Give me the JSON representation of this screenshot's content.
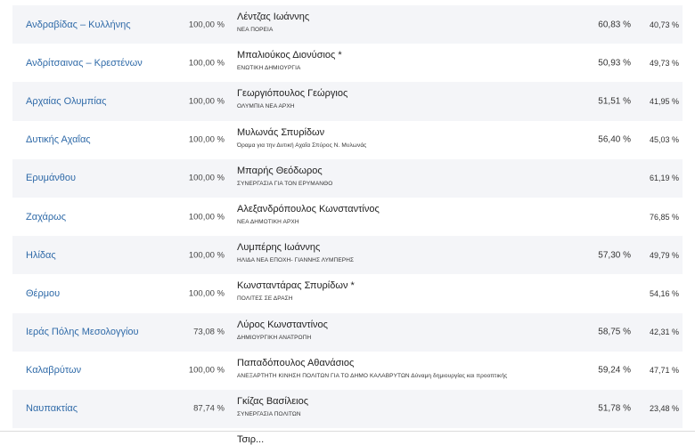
{
  "rows": [
    {
      "municipality": "Ανδραβίδας – Κυλλήνης",
      "count": "100,00 %",
      "name": "Λέντζας Ιωάννης",
      "party": "ΝΕΑ ΠΟΡΕΙΑ",
      "p1": "60,83 %",
      "p2": "40,73 %"
    },
    {
      "municipality": "Ανδρίτσαινας – Κρεστένων",
      "count": "100,00 %",
      "name": "Μπαλιούκος Διονύσιος *",
      "party": "ΕΝΩΤΙΚΗ ΔΗΜΙΟΥΡΓΙΑ",
      "p1": "50,93 %",
      "p2": "49,73 %"
    },
    {
      "municipality": "Αρχαίας Ολυμπίας",
      "count": "100,00 %",
      "name": "Γεωργιόπουλος Γεώργιος",
      "party": "ΟΛΥΜΠΙΑ ΝΕΑ ΑΡΧΗ",
      "p1": "51,51 %",
      "p2": "41,95 %"
    },
    {
      "municipality": "Δυτικής Αχαΐας",
      "count": "100,00 %",
      "name": "Μυλωνάς Σπυρίδων",
      "party": "Όραμα για την Δυτική Αχαΐα Σπύρος Ν. Μυλωνάς",
      "p1": "56,40 %",
      "p2": "45,03 %"
    },
    {
      "municipality": "Ερυμάνθου",
      "count": "100,00 %",
      "name": "Μπαρής Θεόδωρος",
      "party": "ΣΥΝΕΡΓΑΣΙΑ ΓΙΑ ΤΟΝ ΕΡΥΜΑΝΘΟ",
      "p1": "",
      "p2": "61,19 %"
    },
    {
      "municipality": "Ζαχάρως",
      "count": "100,00 %",
      "name": "Αλεξανδρόπουλος Κωνσταντίνος",
      "party": "ΝΕΑ ΔΗΜΟΤΙΚΗ ΑΡΧΗ",
      "p1": "",
      "p2": "76,85 %"
    },
    {
      "municipality": "Ηλίδας",
      "count": "100,00 %",
      "name": "Λυμπέρης Ιωάννης",
      "party": "ΗΛΙΔΑ ΝΕΑ ΕΠΟΧΗ- ΓΙΑΝΝΗΣ ΛΥΜΠΕΡΗΣ",
      "p1": "57,30 %",
      "p2": "49,79 %"
    },
    {
      "municipality": "Θέρμου",
      "count": "100,00 %",
      "name": "Κωνσταντάρας Σπυρίδων *",
      "party": "ΠΟΛΙΤΕΣ ΣΕ ΔΡΑΣΗ",
      "p1": "",
      "p2": "54,16 %"
    },
    {
      "municipality": "Ιεράς Πόλης Μεσολογγίου",
      "count": "73,08 %",
      "name": "Λύρος Κωνσταντίνος",
      "party": "ΔΗΜΙΟΥΡΓΙΚΗ ΑΝΑΤΡΟΠΗ",
      "p1": "58,75 %",
      "p2": "42,31 %"
    },
    {
      "municipality": "Καλαβρύτων",
      "count": "100,00 %",
      "name": "Παπαδόπουλος Αθανάσιος",
      "party": "ΑΝΕΞΑΡΤΗΤΗ ΚΙΝΗΣΗ ΠΟΛΙΤΩΝ ΓΙΑ ΤΟ ΔΗΜΟ ΚΑΛΑΒΡΥΤΩΝ Δύναμη δημιουργίας και προοπτικής",
      "p1": "59,24 %",
      "p2": "47,71 %"
    },
    {
      "municipality": "Ναυπακτίας",
      "count": "87,74 %",
      "name": "Γκίζας Βασίλειος",
      "party": "ΣΥΝΕΡΓΑΣΙΑ ΠΟΛΙΤΩΝ",
      "p1": "51,78 %",
      "p2": "23,48 %"
    }
  ],
  "partial_row_name": "Τσιρ..."
}
